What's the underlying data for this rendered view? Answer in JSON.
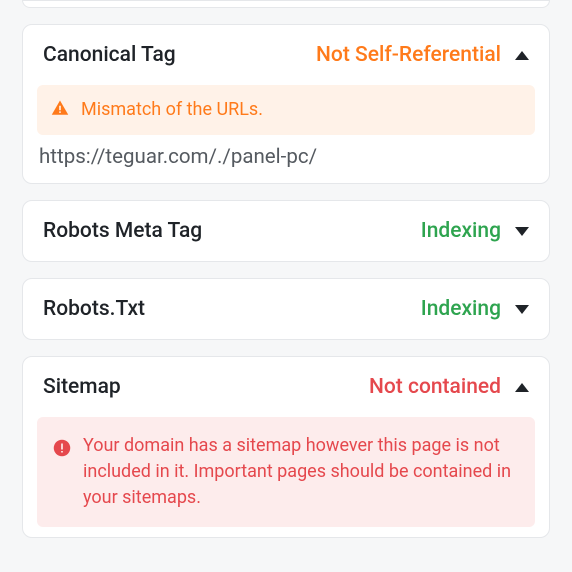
{
  "cards": {
    "canonical": {
      "title": "Canonical Tag",
      "status": "Not Self-Referential",
      "alert": "Mismatch of the URLs.",
      "url": "https://teguar.com/./panel-pc/"
    },
    "robotsMeta": {
      "title": "Robots Meta Tag",
      "status": "Indexing"
    },
    "robotsTxt": {
      "title": "Robots.Txt",
      "status": "Indexing"
    },
    "sitemap": {
      "title": "Sitemap",
      "status": "Not contained",
      "alert": "Your domain has a sitemap however this page is not included in it. Important pages should be contained in your sitemaps."
    }
  }
}
